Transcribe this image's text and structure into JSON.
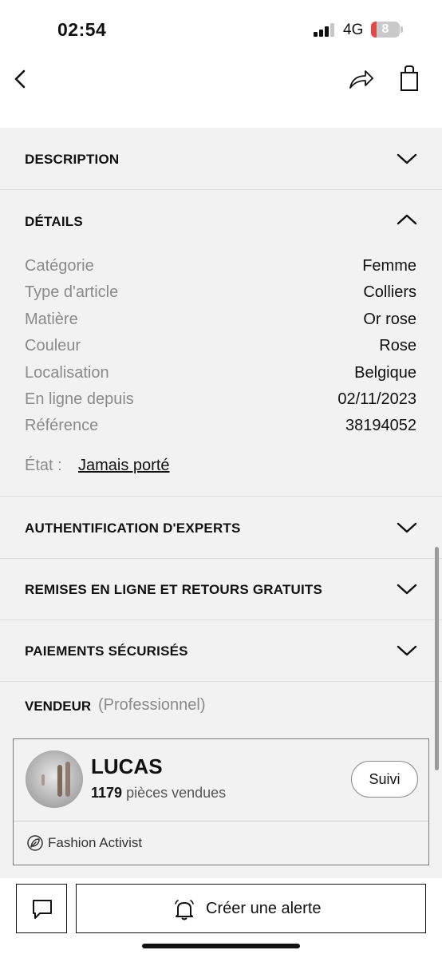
{
  "status_bar": {
    "time": "02:54",
    "network": "4G",
    "battery": "8"
  },
  "nav": {
    "back_icon": "chevron-left-icon",
    "share_icon": "share-icon",
    "bag_icon": "shopping-bag-icon"
  },
  "sections": {
    "description": "DESCRIPTION",
    "details": "DÉTAILS",
    "authentication": "AUTHENTIFICATION D'EXPERTS",
    "returns": "REMISES EN LIGNE ET RETOURS GRATUITS",
    "payments": "PAIEMENTS SÉCURISÉS"
  },
  "details": {
    "rows": [
      {
        "label": "Catégorie",
        "value": "Femme"
      },
      {
        "label": "Type d'article",
        "value": "Colliers"
      },
      {
        "label": "Matière",
        "value": "Or rose"
      },
      {
        "label": "Couleur",
        "value": "Rose"
      },
      {
        "label": "Localisation",
        "value": "Belgique"
      },
      {
        "label": "En ligne depuis",
        "value": "02/11/2023"
      },
      {
        "label": "Référence",
        "value": "38194052"
      }
    ],
    "etat_label": "État :",
    "etat_value": "Jamais porté"
  },
  "seller": {
    "section_title": "VENDEUR",
    "section_sub": "(Professionnel)",
    "name": "LUCAS",
    "sold_count": "1179",
    "sold_label": "pièces vendues",
    "follow_label": "Suivi",
    "badge_label": "Fashion Activist"
  },
  "bottom": {
    "alert_label": "Créer une alerte"
  },
  "colors": {
    "background": "#f2f2f2",
    "text": "#111111",
    "muted": "#8a8a8a",
    "battery": "#e34848"
  }
}
